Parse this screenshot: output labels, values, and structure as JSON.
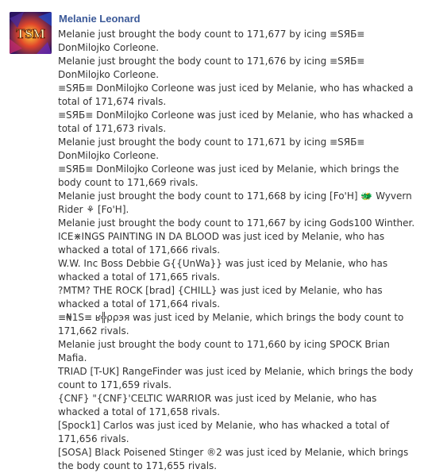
{
  "post": {
    "author": "Melanie Leonard",
    "avatar_icon": "game-logo-avatar",
    "avatar_lettering": "TSM",
    "entries": [
      "Melanie just brought the body count to 171,677 by icing ≡SЯБ≡ DonMilojko Corleone.",
      "Melanie just brought the body count to 171,676 by icing ≡SЯБ≡ DonMilojko Corleone.",
      "≡SЯБ≡ DonMilojko Corleone was just iced by Melanie, who has whacked a total of 171,674 rivals.",
      "≡SЯБ≡ DonMilojko Corleone was just iced by Melanie, who has whacked a total of 171,673 rivals.",
      "Melanie just brought the body count to 171,671 by icing ≡SЯБ≡ DonMilojko Corleone.",
      "≡SЯБ≡ DonMilojko Corleone was just iced by Melanie, which brings the body count to 171,669 rivals.",
      "Melanie just brought the body count to 171,668 by icing [Fo'H] 🐲 Wyvern Rider ⚘ [Fo'H].",
      "Melanie just brought the body count to 171,667 by icing Gods100 Winther.",
      "ICE⋇INGS PAINTING IN DA BLOOD was just iced by Melanie, who has whacked a total of 171,666 rivals.",
      "W.W. Inc Boss Debbie G{{UnWa}} was just iced by Melanie, who has whacked a total of 171,665 rivals.",
      "?MTM? THE ROCK [brad] {CHILL} was just iced by Melanie, who has whacked a total of 171,664 rivals.",
      "≡₦1S≡ ʁ╬ρρэя was just iced by Melanie, which brings the body count to 171,662 rivals.",
      "Melanie just brought the body count to 171,660 by icing SPOCK Brian Mafia.",
      "TRIAD [T-UK] RangeFinder was just iced by Melanie, which brings the body count to 171,659 rivals.",
      "{CNF} \"{CNF}'CELTIC WARRIOR was just iced by Melanie, who has whacked a total of 171,658 rivals.",
      "[Spock1] Carlos was just iced by Melanie, who has whacked a total of 171,656 rivals.",
      "[SOSA] Black Poisened Stinger ®2 was just iced by Melanie, which brings the body count to 171,655 rivals."
    ]
  },
  "colors": {
    "author_link": "#3b5998",
    "body_text": "#333333",
    "background": "#ffffff"
  }
}
